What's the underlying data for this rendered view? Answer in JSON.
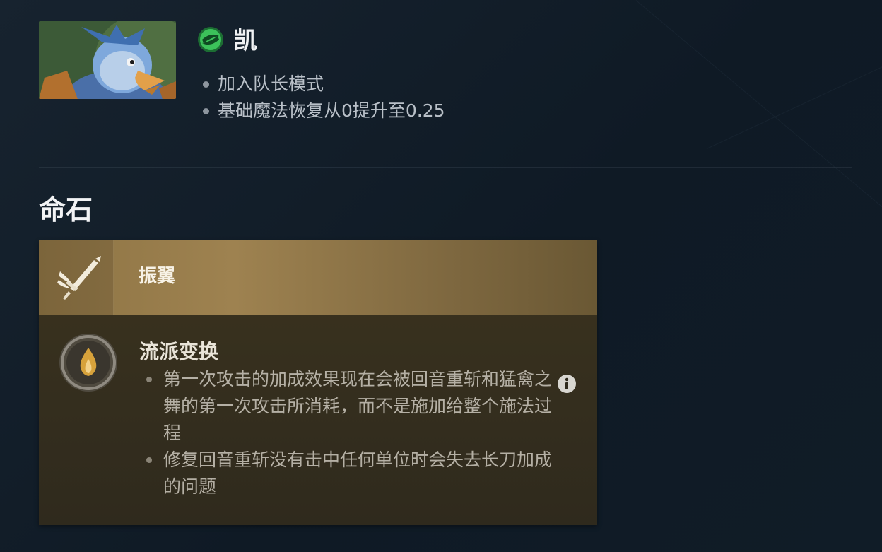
{
  "hero": {
    "name": "凯",
    "changes": [
      "加入队长模式",
      "基础魔法恢复从0提升至0.25"
    ],
    "portrait_icon": "hero-portrait-griffin",
    "type_icon": "universal-attribute-icon"
  },
  "section_title": "命石",
  "facet": {
    "name": "振翼",
    "icon": "sword-wing-icon",
    "ability": {
      "name": "流派变换",
      "icon": "ability-flame-icon",
      "notes": [
        "第一次攻击的加成效果现在会被回音重斩和猛禽之舞的第一次攻击所消耗，而不是施加给整个施法过程",
        "修复回音重斩没有击中任何单位时会失去长刀加成的问题"
      ]
    }
  },
  "colors": {
    "background": "#131f2b",
    "facet_gold": "#9e8250",
    "universal_green": "#3cc25a"
  }
}
